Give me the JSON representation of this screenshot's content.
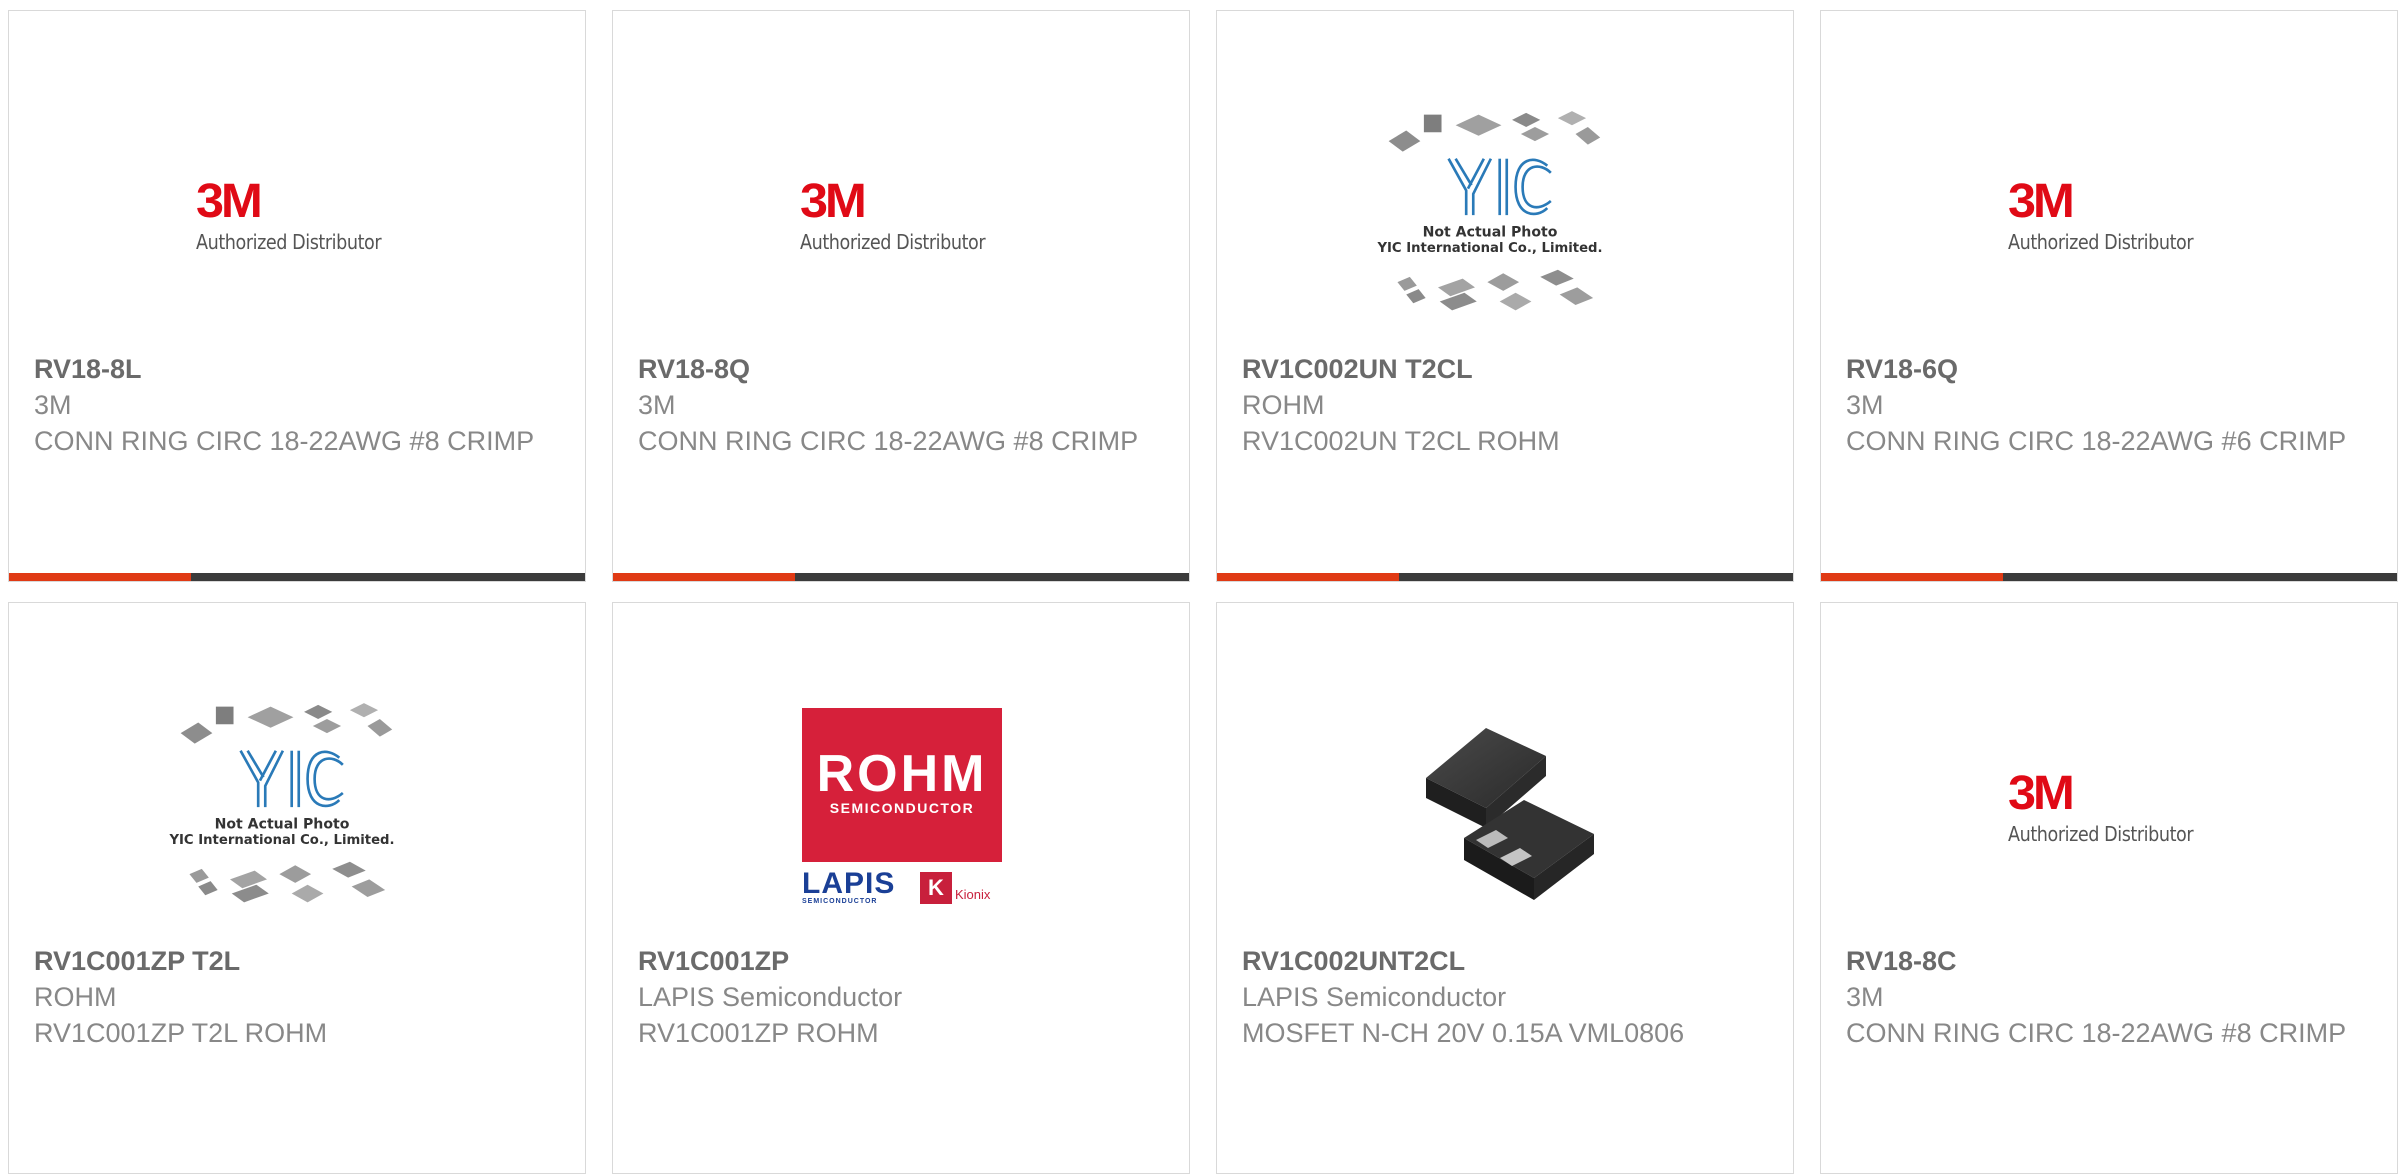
{
  "products": [
    {
      "part": "RV18-8L",
      "manufacturer": "3M",
      "description": "CONN RING CIRC 18-22AWG #8 CRIMP",
      "image": "3m-logo"
    },
    {
      "part": "RV18-8Q",
      "manufacturer": "3M",
      "description": "CONN RING CIRC 18-22AWG #8 CRIMP",
      "image": "3m-logo"
    },
    {
      "part": "RV1C002UN T2CL",
      "manufacturer": "ROHM",
      "description": "RV1C002UN T2CL ROHM",
      "image": "yic-placeholder"
    },
    {
      "part": "RV18-6Q",
      "manufacturer": "3M",
      "description": "CONN RING CIRC 18-22AWG #6 CRIMP",
      "image": "3m-logo"
    },
    {
      "part": "RV1C001ZP T2L",
      "manufacturer": "ROHM",
      "description": "RV1C001ZP T2L ROHM",
      "image": "yic-placeholder"
    },
    {
      "part": "RV1C001ZP",
      "manufacturer": "LAPIS Semiconductor",
      "description": "RV1C001ZP ROHM",
      "image": "rohm-logo"
    },
    {
      "part": "RV1C002UNT2CL",
      "manufacturer": "LAPIS Semiconductor",
      "description": "MOSFET N-CH 20V 0.15A VML0806",
      "image": "chip-photo"
    },
    {
      "part": "RV18-8C",
      "manufacturer": "3M",
      "description": "CONN RING CIRC 18-22AWG #8 CRIMP",
      "image": "3m-logo"
    }
  ],
  "logos": {
    "three_m": {
      "mark": "3M",
      "sub": "Authorized Distributor"
    },
    "yic": {
      "mark": "YIC",
      "line1": "Not Actual Photo",
      "line2": "YIC International Co., Limited."
    },
    "rohm": {
      "mark": "ROHM",
      "sub": "SEMICONDUCTOR",
      "lapis": "LAPIS",
      "lapis_sub": "SEMICONDUCTOR",
      "kionix": "Kionix"
    }
  },
  "colors": {
    "accent": "#e03a14",
    "bar": "#3b3b3b",
    "brand_3m": "#e00a16",
    "rohm_red": "#d6203a",
    "yic_blue": "#2a7ab8",
    "lapis_blue": "#1a3f96"
  }
}
